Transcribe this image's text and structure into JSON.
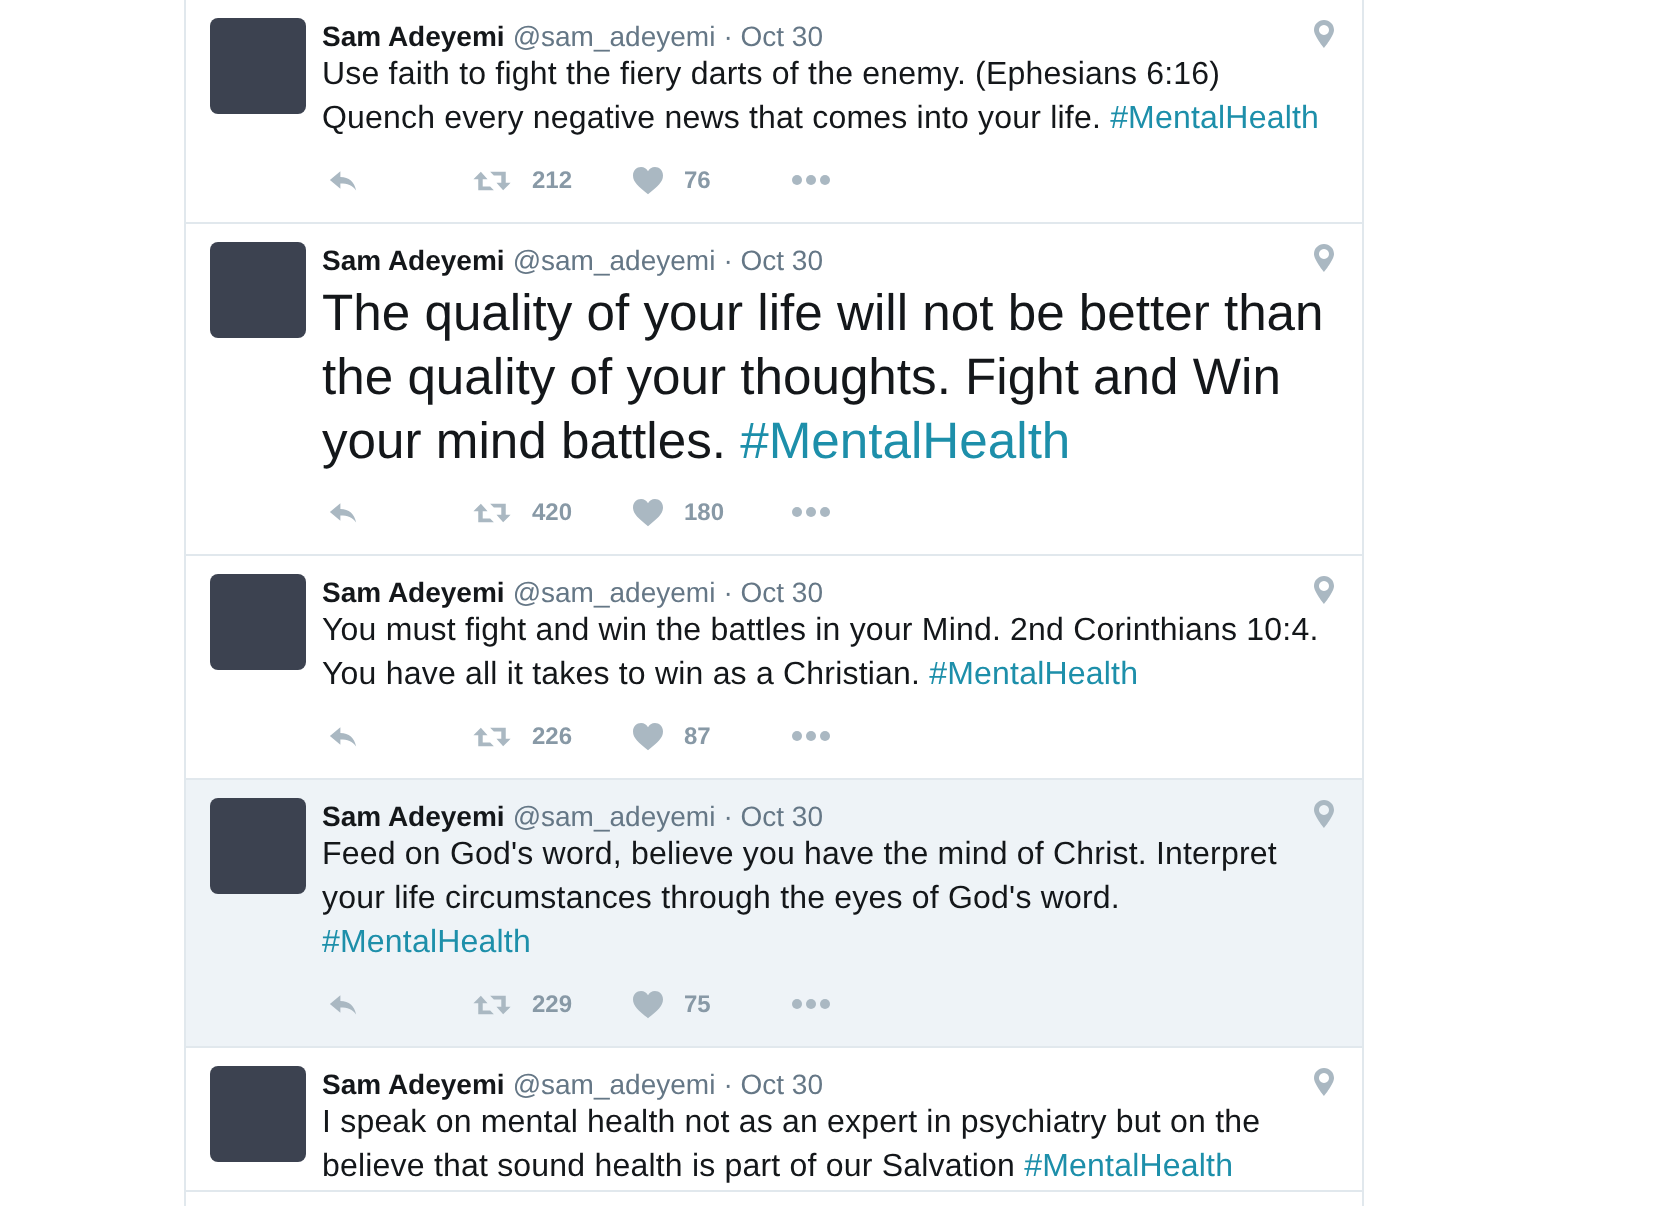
{
  "tweets": [
    {
      "name": "Sam Adeyemi",
      "handle": "@sam_adeyemi",
      "date": "· Oct 30",
      "kind": "normal",
      "highlighted": false,
      "hashtag_newline": false,
      "text": "Use faith to fight the fiery darts of the enemy. (Ephesians 6:16) Quench every negative news that comes into your life.",
      "hashtag": "#MentalHealth",
      "retweets": "212",
      "likes": "76"
    },
    {
      "name": "Sam Adeyemi",
      "handle": "@sam_adeyemi",
      "date": "· Oct 30",
      "kind": "large",
      "highlighted": false,
      "hashtag_newline": false,
      "text": "The quality of your life will not be better than the quality of your thoughts. Fight and Win your mind battles.",
      "hashtag": "#MentalHealth",
      "retweets": "420",
      "likes": "180"
    },
    {
      "name": "Sam Adeyemi",
      "handle": "@sam_adeyemi",
      "date": "· Oct 30",
      "kind": "normal",
      "highlighted": false,
      "hashtag_newline": false,
      "text": "You must fight and win the battles in your Mind. 2nd Corinthians 10:4. You have all it takes to win as a Christian.",
      "hashtag": "#MentalHealth",
      "retweets": "226",
      "likes": "87"
    },
    {
      "name": "Sam Adeyemi",
      "handle": "@sam_adeyemi",
      "date": "· Oct 30",
      "kind": "normal",
      "highlighted": true,
      "hashtag_newline": true,
      "text": "Feed on God's word, believe you have the mind of Christ. Interpret your life circumstances through the eyes of God's word.",
      "hashtag": "#MentalHealth",
      "retweets": "229",
      "likes": "75"
    },
    {
      "name": "Sam Adeyemi",
      "handle": "@sam_adeyemi",
      "date": "· Oct 30",
      "kind": "normal",
      "highlighted": false,
      "hashtag_newline": false,
      "text": "I speak on mental health not as an expert in psychiatry but on the believe that sound health is part of our Salvation",
      "hashtag": "#MentalHealth"
    }
  ]
}
